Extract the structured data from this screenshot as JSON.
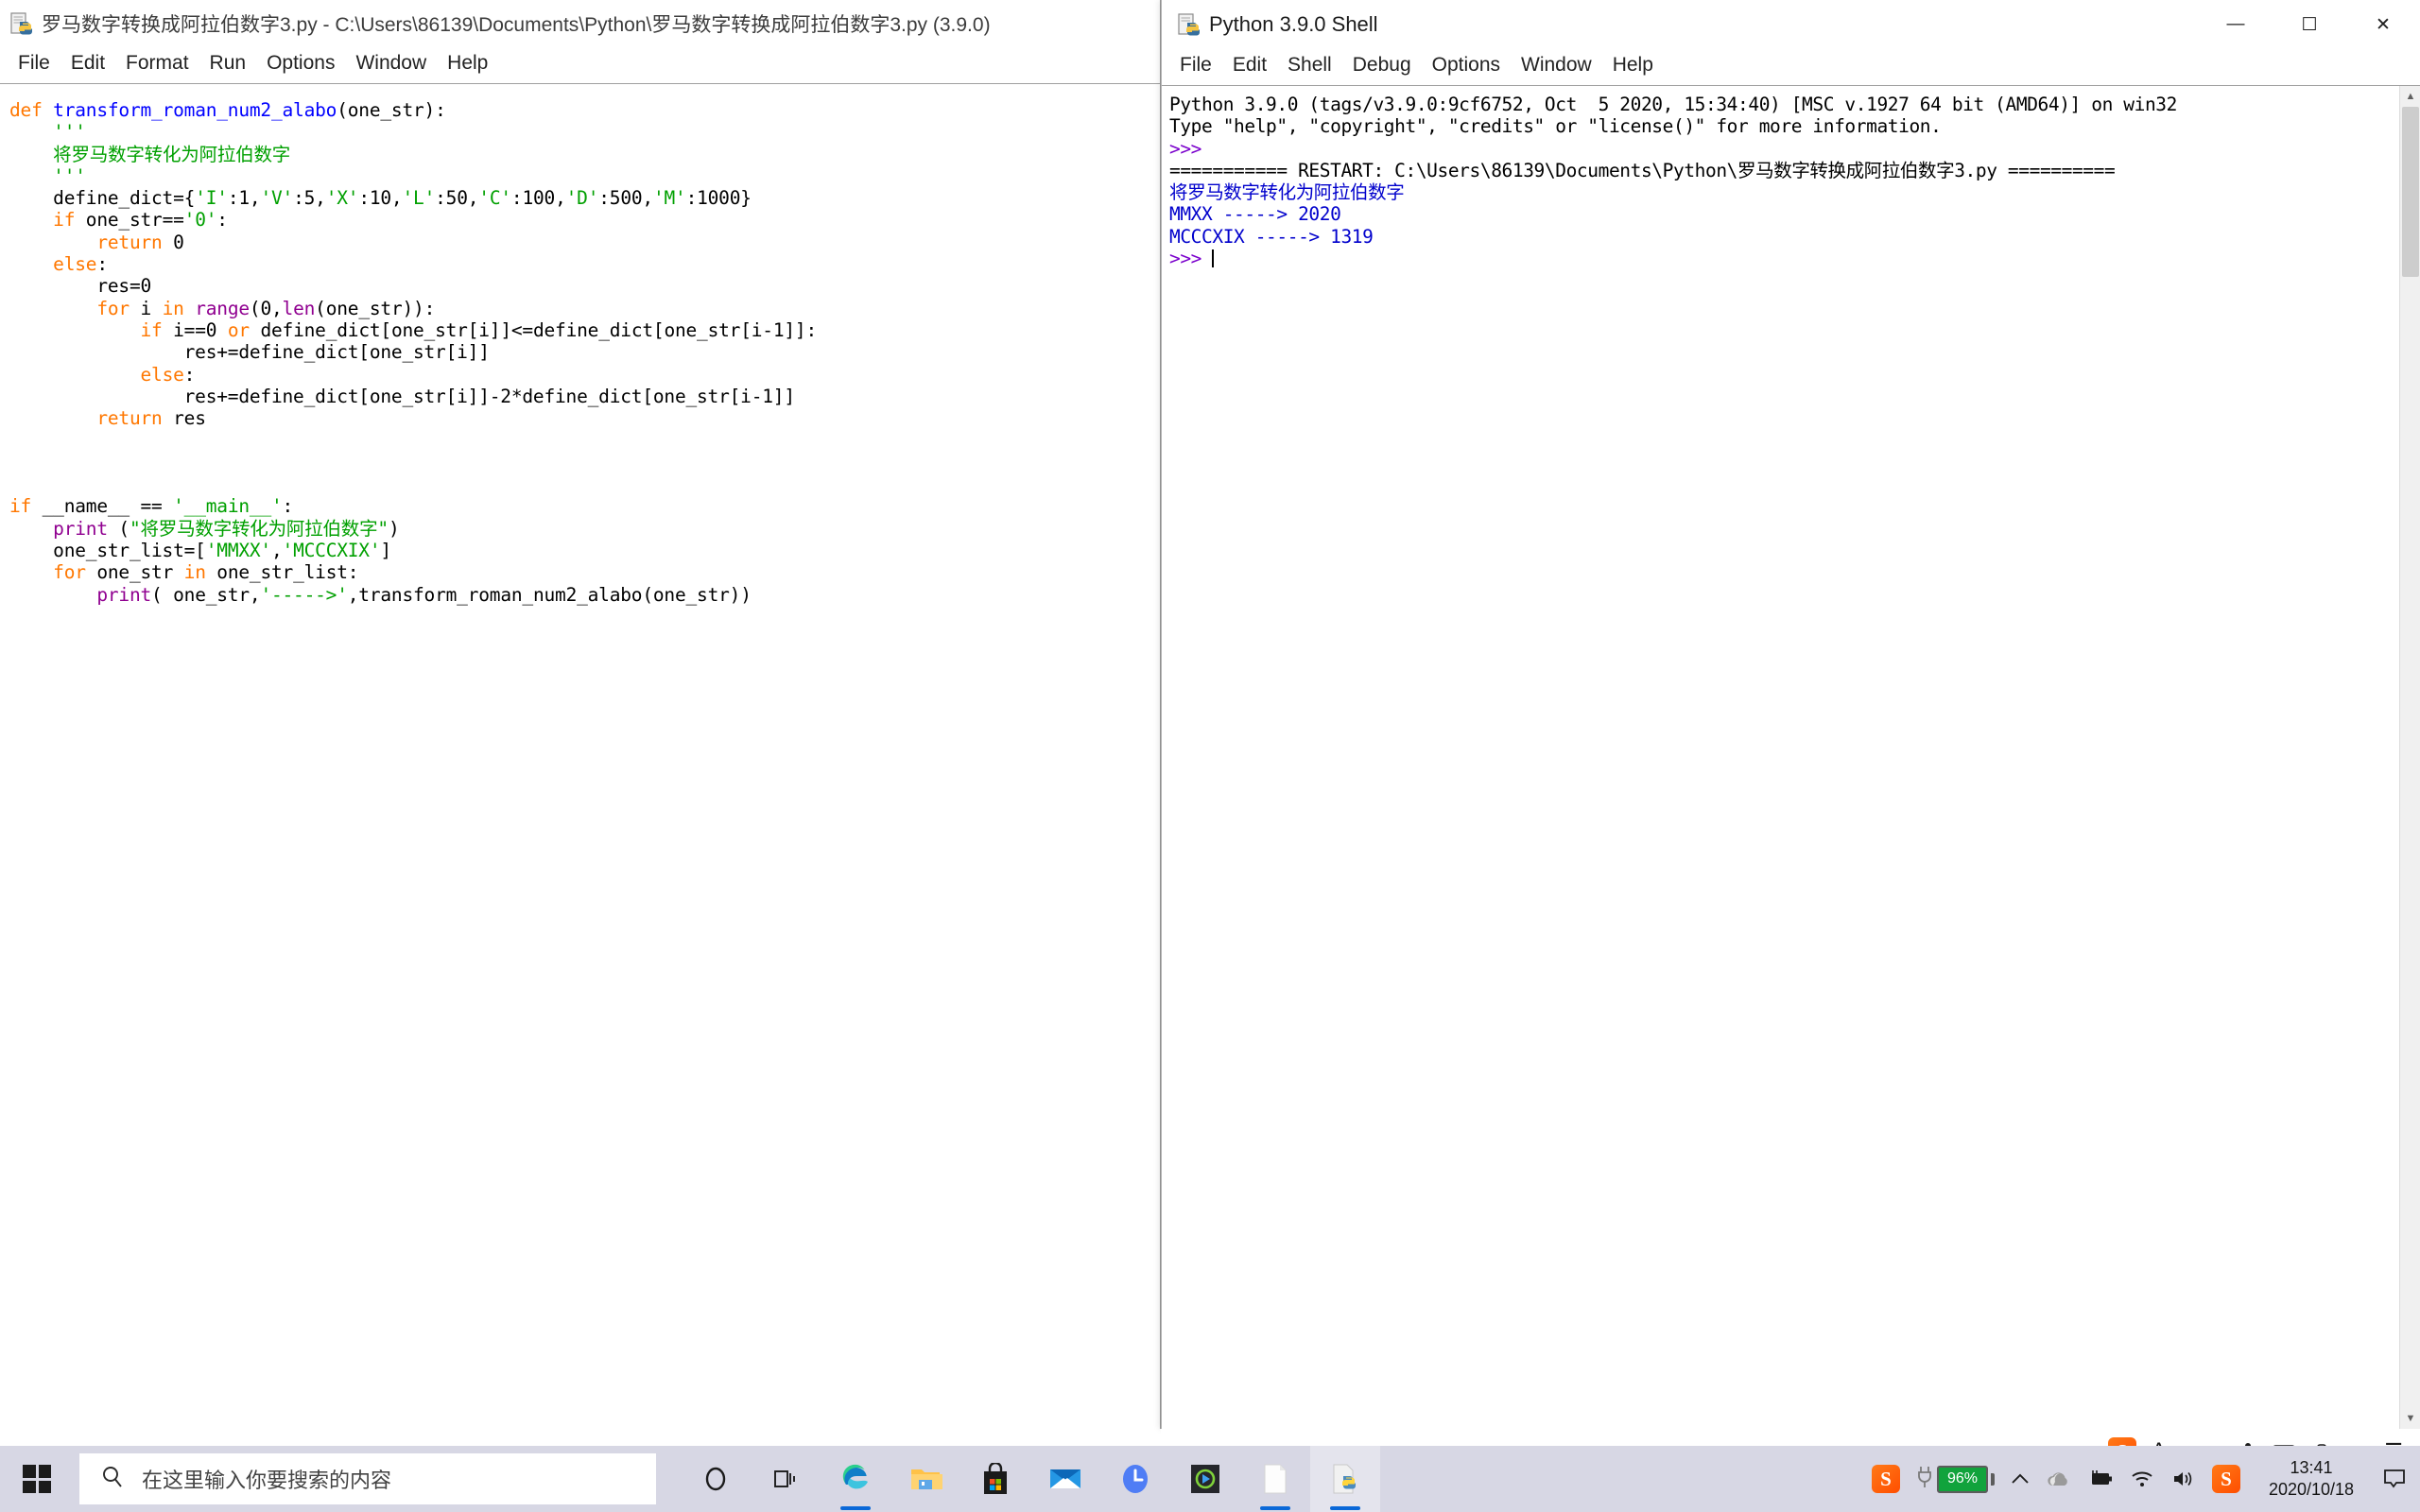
{
  "editor": {
    "title": "罗马数字转换成阿拉伯数字3.py - C:\\Users\\86139\\Documents\\Python\\罗马数字转换成阿拉伯数字3.py (3.9.0)",
    "icon": "python-file-icon",
    "menu": [
      "File",
      "Edit",
      "Format",
      "Run",
      "Options",
      "Window",
      "Help"
    ],
    "code_lines": [
      [
        {
          "t": "def ",
          "c": "kw"
        },
        {
          "t": "transform_roman_num2_alabo",
          "c": "def"
        },
        {
          "t": "(one_str):",
          "c": ""
        }
      ],
      [
        {
          "t": "    ",
          "c": ""
        },
        {
          "t": "'''",
          "c": "str"
        }
      ],
      [
        {
          "t": "    ",
          "c": ""
        },
        {
          "t": "将罗马数字转化为阿拉伯数字",
          "c": "str"
        }
      ],
      [
        {
          "t": "    ",
          "c": ""
        },
        {
          "t": "'''",
          "c": "str"
        }
      ],
      [
        {
          "t": "    define_dict={",
          "c": ""
        },
        {
          "t": "'I'",
          "c": "str"
        },
        {
          "t": ":1,",
          "c": ""
        },
        {
          "t": "'V'",
          "c": "str"
        },
        {
          "t": ":5,",
          "c": ""
        },
        {
          "t": "'X'",
          "c": "str"
        },
        {
          "t": ":10,",
          "c": ""
        },
        {
          "t": "'L'",
          "c": "str"
        },
        {
          "t": ":50,",
          "c": ""
        },
        {
          "t": "'C'",
          "c": "str"
        },
        {
          "t": ":100,",
          "c": ""
        },
        {
          "t": "'D'",
          "c": "str"
        },
        {
          "t": ":500,",
          "c": ""
        },
        {
          "t": "'M'",
          "c": "str"
        },
        {
          "t": ":1000}",
          "c": ""
        }
      ],
      [
        {
          "t": "    ",
          "c": ""
        },
        {
          "t": "if",
          "c": "kw"
        },
        {
          "t": " one_str==",
          "c": ""
        },
        {
          "t": "'0'",
          "c": "str"
        },
        {
          "t": ":",
          "c": ""
        }
      ],
      [
        {
          "t": "        ",
          "c": ""
        },
        {
          "t": "return",
          "c": "kw"
        },
        {
          "t": " 0",
          "c": ""
        }
      ],
      [
        {
          "t": "    ",
          "c": ""
        },
        {
          "t": "else",
          "c": "kw"
        },
        {
          "t": ":",
          "c": ""
        }
      ],
      [
        {
          "t": "        res=0",
          "c": ""
        }
      ],
      [
        {
          "t": "        ",
          "c": ""
        },
        {
          "t": "for",
          "c": "kw"
        },
        {
          "t": " i ",
          "c": ""
        },
        {
          "t": "in",
          "c": "kw"
        },
        {
          "t": " ",
          "c": ""
        },
        {
          "t": "range",
          "c": "bif"
        },
        {
          "t": "(0,",
          "c": ""
        },
        {
          "t": "len",
          "c": "bif"
        },
        {
          "t": "(one_str)):",
          "c": ""
        }
      ],
      [
        {
          "t": "            ",
          "c": ""
        },
        {
          "t": "if",
          "c": "kw"
        },
        {
          "t": " i==0 ",
          "c": ""
        },
        {
          "t": "or",
          "c": "kw"
        },
        {
          "t": " define_dict[one_str[i]]<=define_dict[one_str[i-1]]:",
          "c": ""
        }
      ],
      [
        {
          "t": "                res+=define_dict[one_str[i]]",
          "c": ""
        }
      ],
      [
        {
          "t": "            ",
          "c": ""
        },
        {
          "t": "else",
          "c": "kw"
        },
        {
          "t": ":",
          "c": ""
        }
      ],
      [
        {
          "t": "                res+=define_dict[one_str[i]]-2*define_dict[one_str[i-1]]",
          "c": ""
        }
      ],
      [
        {
          "t": "        ",
          "c": ""
        },
        {
          "t": "return",
          "c": "kw"
        },
        {
          "t": " res",
          "c": ""
        }
      ],
      [
        {
          "t": "",
          "c": ""
        }
      ],
      [
        {
          "t": "",
          "c": ""
        }
      ],
      [
        {
          "t": "",
          "c": ""
        }
      ],
      [
        {
          "t": "if",
          "c": "kw"
        },
        {
          "t": " __name__ == ",
          "c": ""
        },
        {
          "t": "'__main__'",
          "c": "str"
        },
        {
          "t": ":",
          "c": ""
        }
      ],
      [
        {
          "t": "    ",
          "c": ""
        },
        {
          "t": "print",
          "c": "bif"
        },
        {
          "t": " (",
          "c": ""
        },
        {
          "t": "\"将罗马数字转化为阿拉伯数字\"",
          "c": "str"
        },
        {
          "t": ")",
          "c": ""
        }
      ],
      [
        {
          "t": "    one_str_list=[",
          "c": ""
        },
        {
          "t": "'MMXX'",
          "c": "str"
        },
        {
          "t": ",",
          "c": ""
        },
        {
          "t": "'MCCCXIX'",
          "c": "str"
        },
        {
          "t": "]",
          "c": ""
        }
      ],
      [
        {
          "t": "    ",
          "c": ""
        },
        {
          "t": "for",
          "c": "kw"
        },
        {
          "t": " one_str ",
          "c": ""
        },
        {
          "t": "in",
          "c": "kw"
        },
        {
          "t": " one_str_list:",
          "c": ""
        }
      ],
      [
        {
          "t": "        ",
          "c": ""
        },
        {
          "t": "print",
          "c": "bif"
        },
        {
          "t": "( one_str,",
          "c": ""
        },
        {
          "t": "'----->'",
          "c": "str"
        },
        {
          "t": ",transform_roman_num2_alabo(one_str))",
          "c": ""
        }
      ]
    ]
  },
  "shell": {
    "title": "Python 3.9.0 Shell",
    "icon": "python-shell-icon",
    "menu": [
      "File",
      "Edit",
      "Shell",
      "Debug",
      "Options",
      "Window",
      "Help"
    ],
    "window_buttons": {
      "minimize": "—",
      "maximize": "☐",
      "close": "✕"
    },
    "lines": [
      [
        {
          "t": "Python 3.9.0 (tags/v3.9.0:9cf6752, Oct  5 2020, 15:34:40) [MSC v.1927 64 bit (AMD64)] on win32",
          "c": ""
        }
      ],
      [
        {
          "t": "Type \"help\", \"copyright\", \"credits\" or \"license()\" for more information.",
          "c": ""
        }
      ],
      [
        {
          "t": ">>> ",
          "c": "sh-prompt"
        }
      ],
      [
        {
          "t": "=========== RESTART: C:\\Users\\86139\\Documents\\Python\\罗马数字转换成阿拉伯数字3.py ==========",
          "c": ""
        }
      ],
      [
        {
          "t": "将罗马数字转化为阿拉伯数字",
          "c": "sh-out"
        }
      ],
      [
        {
          "t": "MMXX -----> 2020",
          "c": "sh-out"
        }
      ],
      [
        {
          "t": "MCCCXIX -----> 1319",
          "c": "sh-out"
        }
      ],
      [
        {
          "t": ">>> ",
          "c": "sh-prompt"
        }
      ]
    ]
  },
  "taskbar": {
    "start": "start-button",
    "search": {
      "placeholder": "在这里输入你要搜索的内容",
      "icon": "search-icon"
    },
    "items": [
      {
        "name": "cortana-icon",
        "running": false
      },
      {
        "name": "task-view-icon",
        "running": false
      },
      {
        "name": "microsoft-edge-icon",
        "running": true
      },
      {
        "name": "file-explorer-icon",
        "running": false
      },
      {
        "name": "microsoft-store-icon",
        "running": false
      },
      {
        "name": "mail-icon",
        "running": false
      },
      {
        "name": "lark-icon",
        "running": false
      },
      {
        "name": "potplayer-icon",
        "running": false
      },
      {
        "name": "notepad-icon",
        "running": true
      },
      {
        "name": "python-idle-icon",
        "running": true
      }
    ],
    "tray": {
      "battery_percent": "96%",
      "icons": [
        "sogou-input-icon",
        "chevron-up-icon",
        "onedrive-icon",
        "battery-charging-icon",
        "wifi-icon",
        "volume-icon",
        "sogou-pinyin-icon"
      ],
      "time": "13:41",
      "date": "2020/10/18",
      "action_center": "notification-icon"
    },
    "ime_bar": [
      "sogou-logo-icon",
      "language-A-icon",
      "comma-icon",
      "smiley-icon",
      "microphone-icon",
      "keyboard-icon",
      "toolbox-icon",
      "gift-icon",
      "menu-icon"
    ]
  }
}
